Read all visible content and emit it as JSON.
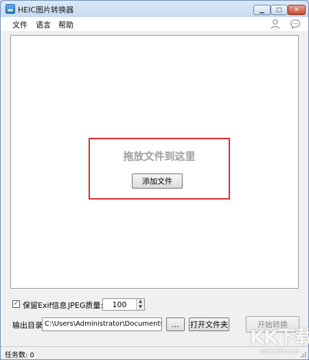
{
  "window": {
    "title": "HEIC图片转换器"
  },
  "titlebar_buttons": {
    "minimize": "▁",
    "maximize": "□",
    "close": "✕"
  },
  "menu": [
    {
      "label": "文件"
    },
    {
      "label": "语言"
    },
    {
      "label": "帮助"
    }
  ],
  "header_icons": [
    "user-icon",
    "chat-bubble-icon"
  ],
  "dropzone": {
    "prompt": "拖放文件到这里",
    "add_button": "添加文件",
    "highlight_color": "#e0262a"
  },
  "options": {
    "keep_exif": {
      "checked": true,
      "check_mark": "✓",
      "label": "保留Exif信息"
    },
    "jpeg_quality": {
      "label": "JPEG质量:",
      "value": "100",
      "up": "▲",
      "down": "▼"
    }
  },
  "output": {
    "label": "输出目录:",
    "path": "C:\\Users\\Administrator\\Documents\\Apo",
    "browse_button": "...",
    "open_folder_button": "打开文件夹",
    "start_button": "开始转换"
  },
  "status": {
    "task_count": "任务数: 0"
  },
  "watermark": {
    "logo": "KK下载",
    "url": "www.kkx.net"
  }
}
